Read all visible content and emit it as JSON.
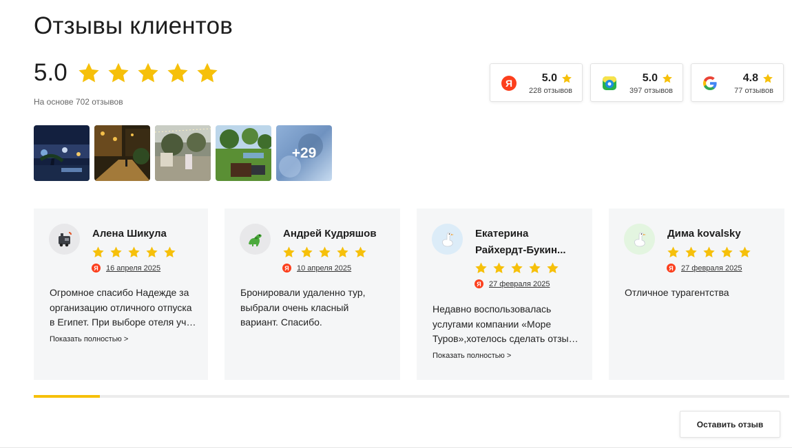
{
  "header": {
    "title": "Отзывы клиентов",
    "rating": "5.0",
    "stars": 5,
    "subtitle": "На основе 702 отзывов"
  },
  "sources": [
    {
      "name": "Yandex",
      "icon": "yandex-icon",
      "score": "5.0",
      "count": "228 отзывов"
    },
    {
      "name": "2GIS",
      "icon": "2gis-icon",
      "score": "5.0",
      "count": "397 отзывов"
    },
    {
      "name": "Google",
      "icon": "google-icon",
      "score": "4.8",
      "count": "77 отзывов"
    }
  ],
  "photos": {
    "more_label": "+29"
  },
  "reviews": [
    {
      "author": "Алена Шикула",
      "avatar_icon": "train-icon",
      "stars": 5,
      "source_icon": "yandex-icon",
      "date": "16 апреля 2025",
      "text": "Огромное спасибо Надежде за организацию отличного отпуска в Египет. При выборе отеля учли все наши пожелания.",
      "more": "Показать полностью >"
    },
    {
      "author": "Андрей Кудряшов",
      "avatar_icon": "dinosaur-icon",
      "stars": 5,
      "source_icon": "yandex-icon",
      "date": "10 апреля 2025",
      "text": "Бронировали удаленно тур, выбрали очень класный вариант. Спасибо.",
      "more": ""
    },
    {
      "author": "Екатерина Райхердт-Букин...",
      "avatar_icon": "goose-icon",
      "stars": 5,
      "source_icon": "yandex-icon",
      "date": "27 февраля 2025",
      "text": "Недавно воспользовалась услугами компании «Море Туров»,хотелось сделать отзыв о работе менеджера.",
      "more": "Показать полностью >"
    },
    {
      "author": "Дима kovalsky",
      "avatar_icon": "goose-icon",
      "stars": 5,
      "source_icon": "yandex-icon",
      "date": "27 февраля 2025",
      "text": "Отличное турагентства",
      "more": ""
    }
  ],
  "carousel": {
    "progress": 0.0875
  },
  "actions": {
    "leave_review": "Оставить отзыв"
  },
  "colors": {
    "star": "#f6c00a",
    "yandex": "#fc3f1d",
    "card_bg": "#f5f6f7",
    "progress": "#f6c00a"
  }
}
